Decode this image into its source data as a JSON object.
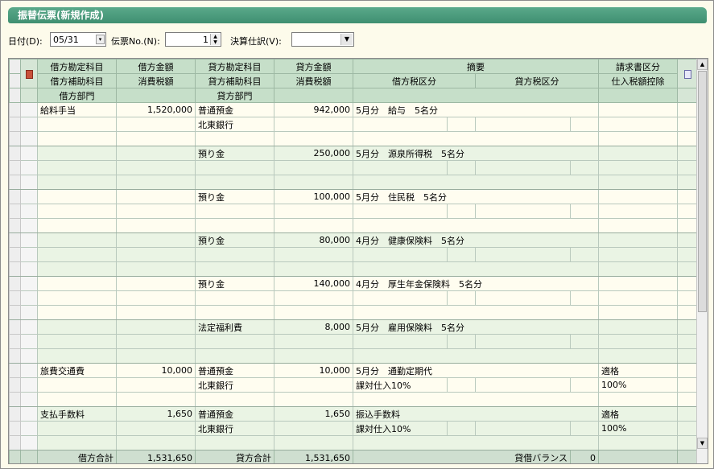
{
  "window": {
    "title": "振替伝票(新規作成)"
  },
  "toolbar": {
    "date_label": "日付(D):",
    "date_value": "05/31",
    "slip_label": "伝票No.(N):",
    "slip_value": "1",
    "closing_label": "決算仕訳(V):",
    "closing_value": ""
  },
  "headers": {
    "r1": [
      "借方勘定科目",
      "借方金額",
      "貸方勘定科目",
      "貸方金額",
      "摘要",
      "請求書区分"
    ],
    "r2": [
      "借方補助科目",
      "消費税額",
      "貸方補助科目",
      "消費税額",
      "借方税区分",
      "貸方税区分",
      "仕入税額控除"
    ],
    "r3": [
      "借方部門",
      "貸方部門"
    ]
  },
  "entries": [
    {
      "debit_account": "給料手当",
      "debit_amount": "1,520,000",
      "credit_account": "普通預金",
      "credit_amount": "942,000",
      "memo": "5月分　給与　5名分",
      "credit_sub": "北東銀行",
      "debit_tax": "",
      "invoice": "",
      "deduction": ""
    },
    {
      "debit_account": "",
      "debit_amount": "",
      "credit_account": "預り金",
      "credit_amount": "250,000",
      "memo": "5月分　源泉所得税　5名分",
      "credit_sub": "",
      "debit_tax": "",
      "invoice": "",
      "deduction": ""
    },
    {
      "debit_account": "",
      "debit_amount": "",
      "credit_account": "預り金",
      "credit_amount": "100,000",
      "memo": "5月分　住民税　5名分",
      "credit_sub": "",
      "debit_tax": "",
      "invoice": "",
      "deduction": ""
    },
    {
      "debit_account": "",
      "debit_amount": "",
      "credit_account": "預り金",
      "credit_amount": "80,000",
      "memo": "4月分　健康保険料　5名分",
      "credit_sub": "",
      "debit_tax": "",
      "invoice": "",
      "deduction": ""
    },
    {
      "debit_account": "",
      "debit_amount": "",
      "credit_account": "預り金",
      "credit_amount": "140,000",
      "memo": "4月分　厚生年金保険料　5名分",
      "credit_sub": "",
      "debit_tax": "",
      "invoice": "",
      "deduction": ""
    },
    {
      "debit_account": "",
      "debit_amount": "",
      "credit_account": "法定福利費",
      "credit_amount": "8,000",
      "memo": "5月分　雇用保険料　5名分",
      "credit_sub": "",
      "debit_tax": "",
      "invoice": "",
      "deduction": ""
    },
    {
      "debit_account": "旅費交通費",
      "debit_amount": "10,000",
      "credit_account": "普通預金",
      "credit_amount": "10,000",
      "memo": "5月分　通勤定期代",
      "credit_sub": "北東銀行",
      "debit_tax": "課対仕入10%",
      "invoice": "適格",
      "deduction": "100%"
    },
    {
      "debit_account": "支払手数料",
      "debit_amount": "1,650",
      "credit_account": "普通預金",
      "credit_amount": "1,650",
      "memo": "振込手数料",
      "credit_sub": "北東銀行",
      "debit_tax": "課対仕入10%",
      "invoice": "適格",
      "deduction": "100%"
    }
  ],
  "totals": {
    "debit_label": "借方合計",
    "debit_total": "1,531,650",
    "credit_label": "貸方合計",
    "credit_total": "1,531,650",
    "balance_label": "貸借バランス",
    "balance_value": "0"
  }
}
